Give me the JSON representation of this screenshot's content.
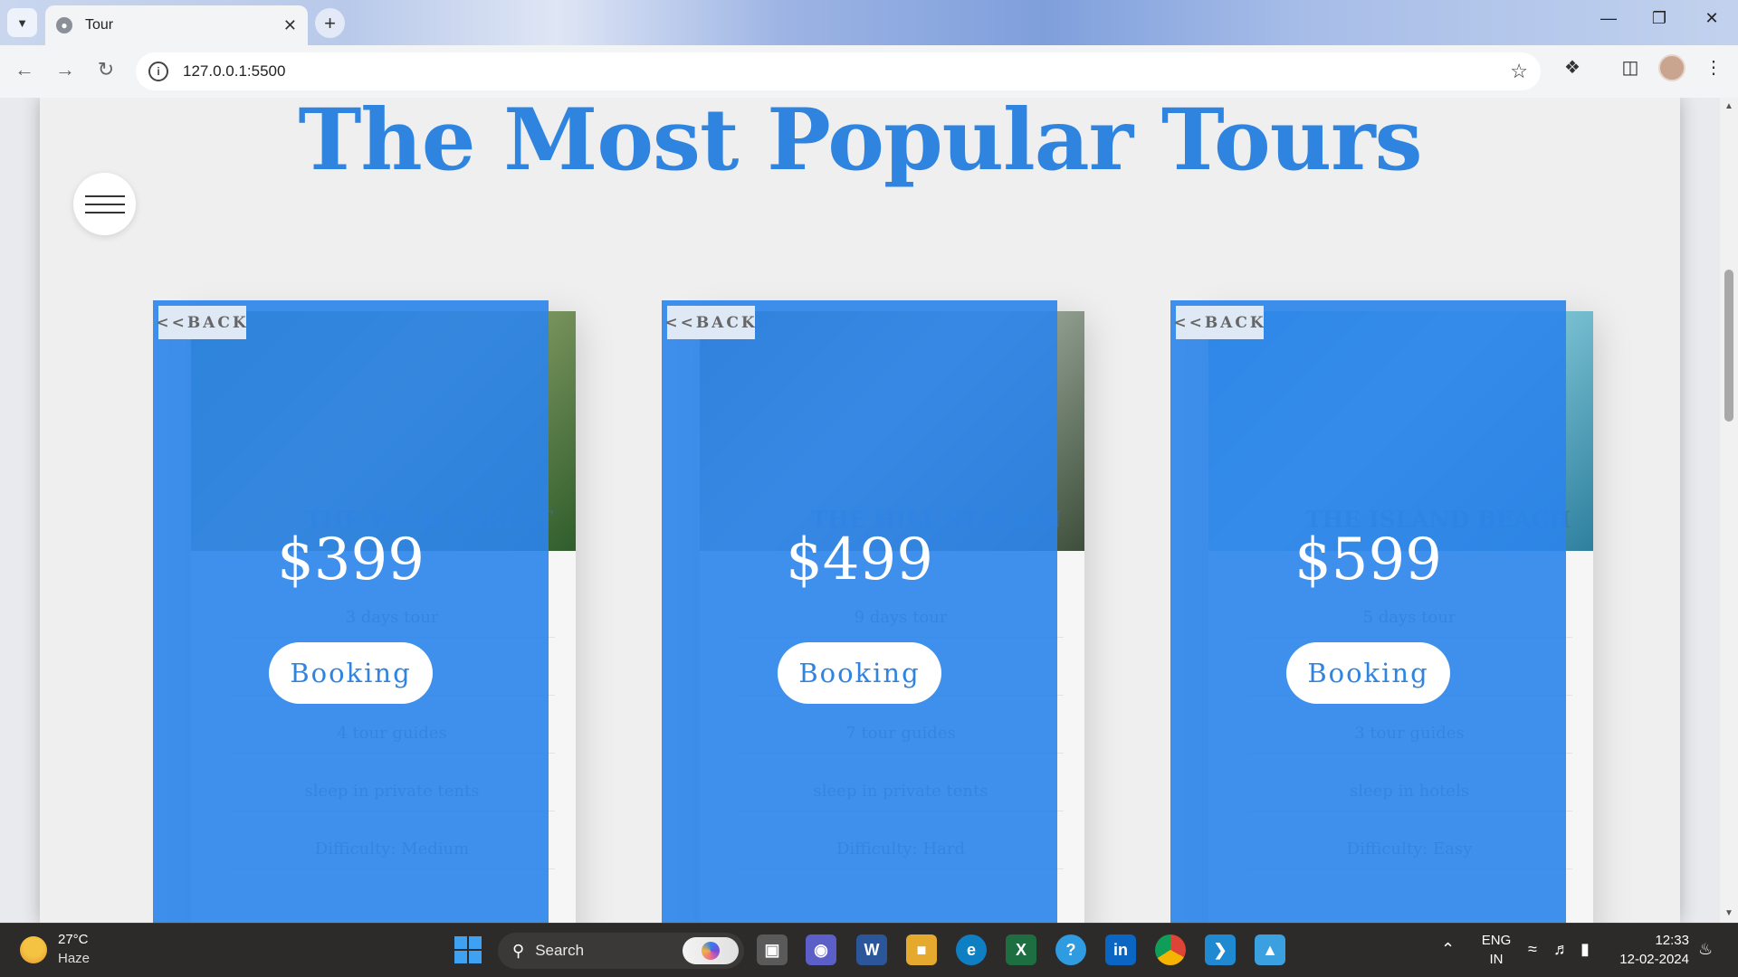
{
  "browser": {
    "tab_title": "Tour",
    "url": "127.0.0.1:5500"
  },
  "page": {
    "heading": "The Most Popular Tours",
    "tours": [
      {
        "image_label": "THE WILD FOREST",
        "back_label": "<<BACK",
        "price": "$399",
        "booking_label": "Booking",
        "details": [
          "3 days tour",
          "",
          "4 tour guides",
          "sleep in private tents",
          "Difficulty: Medium"
        ],
        "image_colors": [
          "#3f7a3c",
          "#8ea26a",
          "#2f5d2c"
        ]
      },
      {
        "image_label": "THE HILL STATION",
        "back_label": "<<BACK",
        "price": "$499",
        "booking_label": "Booking",
        "details": [
          "9 days tour",
          "",
          "7 tour guides",
          "sleep in private tents",
          "Difficulty: Hard"
        ],
        "image_colors": [
          "#5b6b4e",
          "#a8b4a8",
          "#3d4f3a"
        ]
      },
      {
        "image_label": "THE ISLAND BEACH",
        "back_label": "<<BACK",
        "price": "$599",
        "booking_label": "Booking",
        "details": [
          "5 days tour",
          "",
          "3 tour guides",
          "sleep in hotels",
          "Difficulty: Easy"
        ],
        "image_colors": [
          "#4aa7c9",
          "#8fd2e0",
          "#2d7f9e"
        ]
      }
    ]
  },
  "taskbar": {
    "weather_temp": "27°C",
    "weather_desc": "Haze",
    "search_label": "Search",
    "lang_line1": "ENG",
    "lang_line2": "IN",
    "time": "12:33",
    "date": "12-02-2024"
  },
  "colors": {
    "accent": "#2f84df",
    "card_overlay": "#2c84ea"
  }
}
